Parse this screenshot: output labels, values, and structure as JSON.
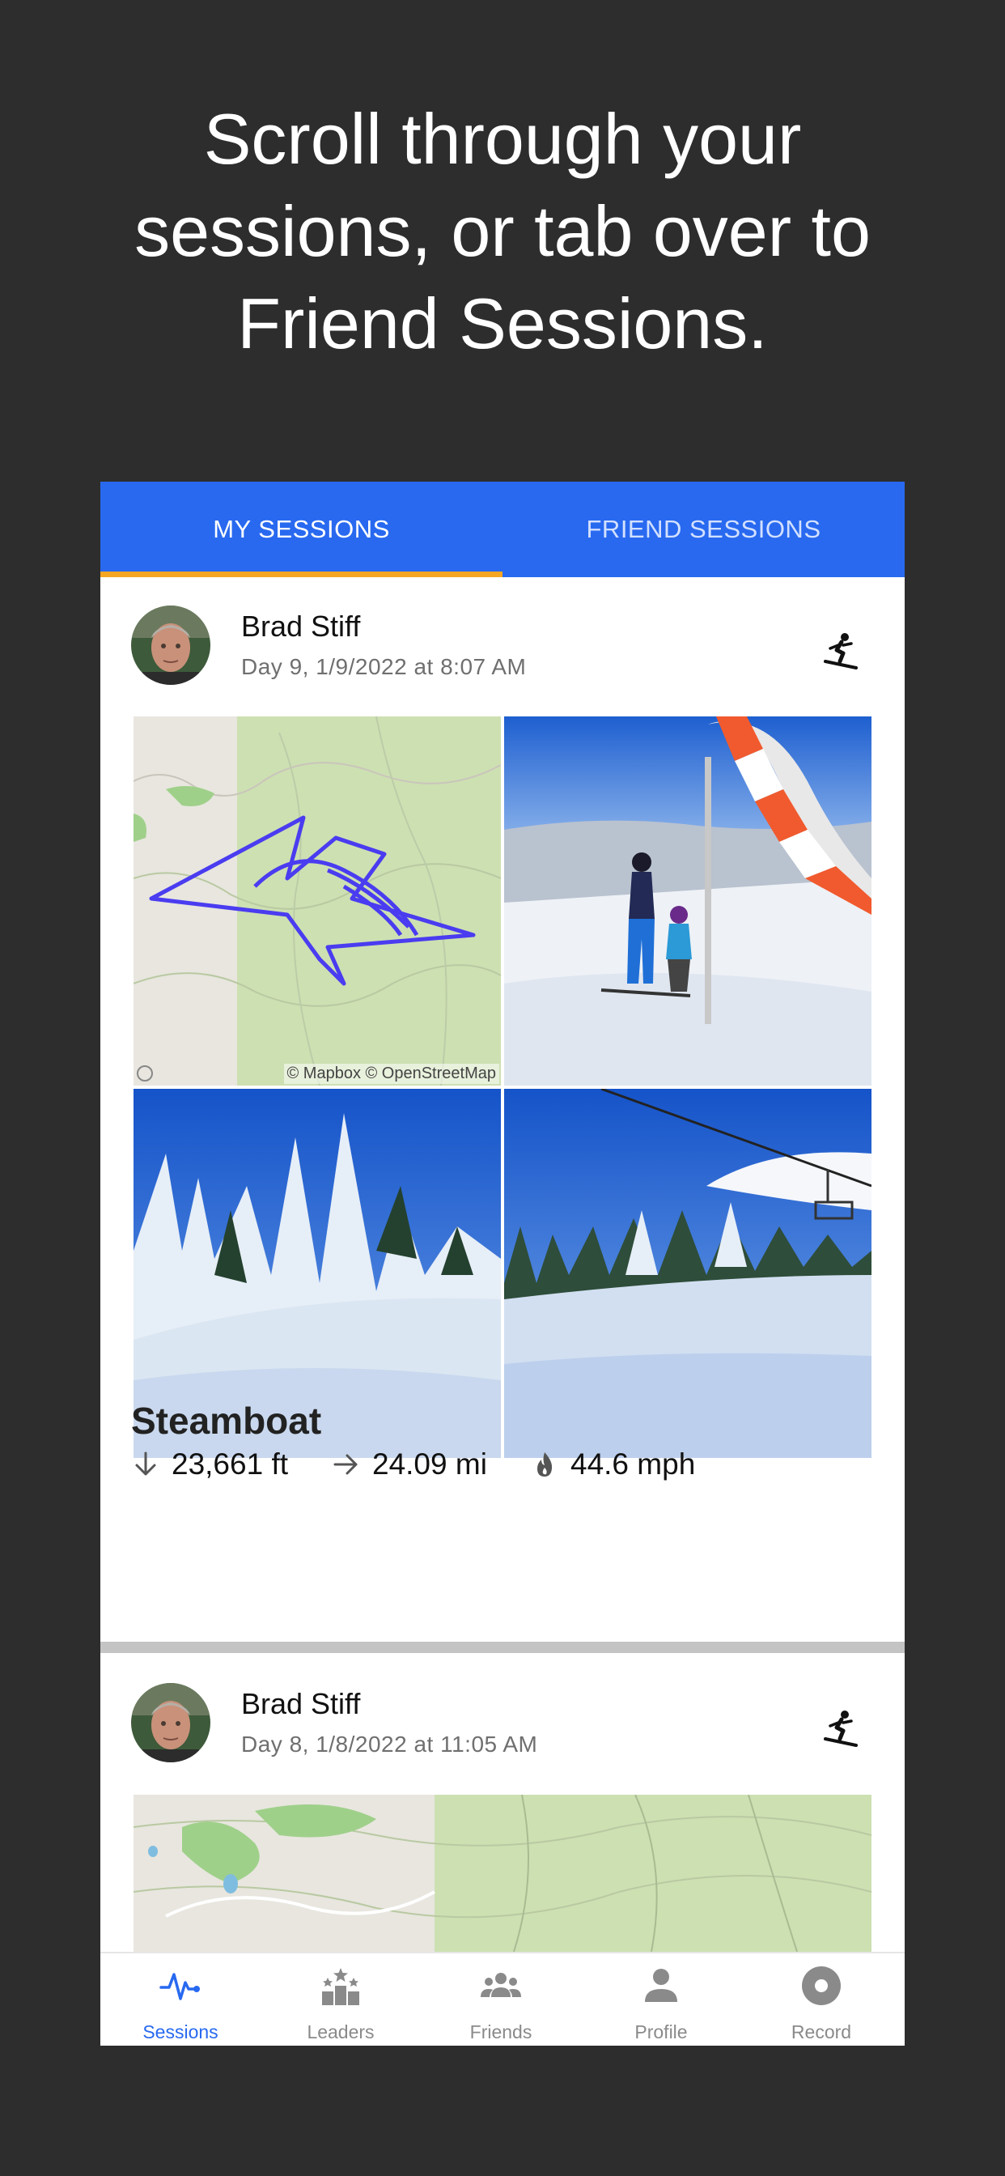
{
  "headline": {
    "line1": "Scroll through your",
    "line2": "sessions, or tab over to",
    "line3": "Friend Sessions."
  },
  "tabs": [
    {
      "label": "MY SESSIONS",
      "active": true
    },
    {
      "label": "FRIEND SESSIONS",
      "active": false
    }
  ],
  "sessions": [
    {
      "user_name": "Brad Stiff",
      "date": "Day 9, 1/9/2022 at 8:07 AM",
      "sport_icon": "snowboard-icon",
      "map_credit": "© Mapbox © OpenStreetMap",
      "resort": "Steamboat",
      "stats": {
        "vertical": "23,661 ft",
        "distance": "24.09 mi",
        "top_speed": "44.6 mph"
      }
    },
    {
      "user_name": "Brad Stiff",
      "date": "Day 8, 1/8/2022 at 11:05 AM",
      "sport_icon": "snowboard-icon"
    }
  ],
  "bottom_nav": [
    {
      "label": "Sessions",
      "icon": "pulse-icon",
      "active": true
    },
    {
      "label": "Leaders",
      "icon": "leaderboard-icon",
      "active": false
    },
    {
      "label": "Friends",
      "icon": "friends-icon",
      "active": false
    },
    {
      "label": "Profile",
      "icon": "person-icon",
      "active": false
    },
    {
      "label": "Record",
      "icon": "record-icon",
      "active": false
    }
  ],
  "colors": {
    "background": "#2d2d2d",
    "accent": "#2869f0",
    "tab_indicator": "#f5a623",
    "track": "#4a3cf0"
  }
}
